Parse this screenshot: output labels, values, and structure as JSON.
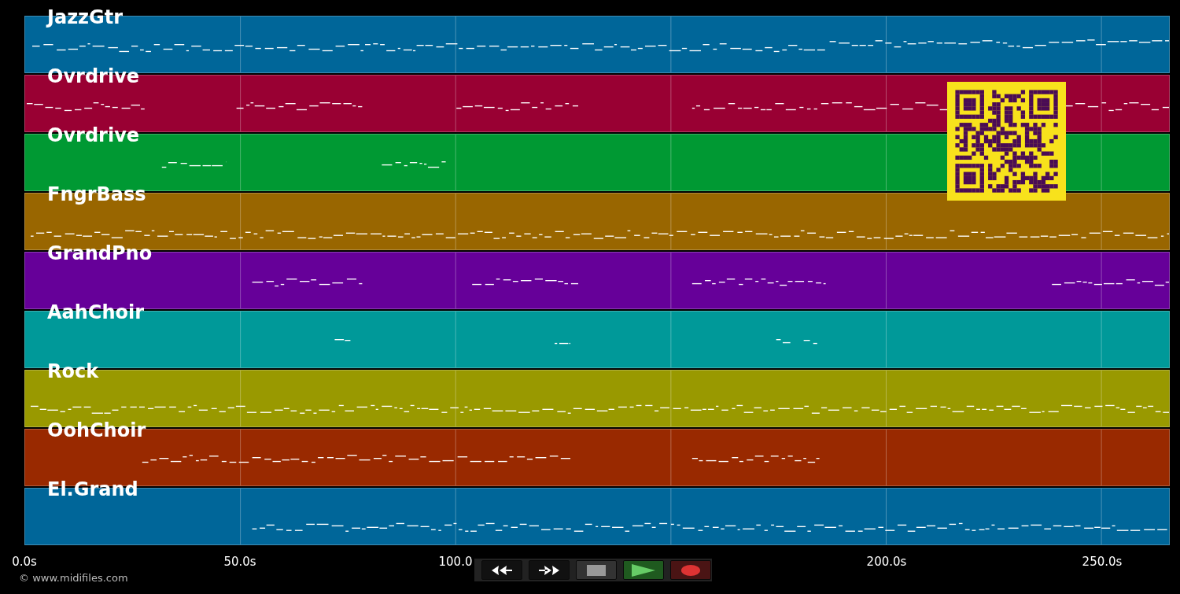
{
  "tracks": [
    {
      "name": "JazzGtr",
      "color": "#006699"
    },
    {
      "name": "Ovrdrive",
      "color": "#990033"
    },
    {
      "name": "Ovrdrive",
      "color": "#009933"
    },
    {
      "name": "FngrBass",
      "color": "#996600"
    },
    {
      "name": "GrandPno",
      "color": "#660099"
    },
    {
      "name": "AahChoir",
      "color": "#009999"
    },
    {
      "name": "Rock",
      "color": "#999900"
    },
    {
      "name": "OohChoir",
      "color": "#992900"
    },
    {
      "name": "El.Grand",
      "color": "#006699"
    }
  ],
  "time_axis": {
    "labels": [
      "0.0s",
      "50.0s",
      "100.0",
      "200.0s",
      "250.0s"
    ]
  },
  "transport": [
    {
      "kind": "rewind"
    },
    {
      "kind": "fast_forward"
    },
    {
      "kind": "stop"
    },
    {
      "kind": "play"
    },
    {
      "kind": "record"
    }
  ],
  "footer": {
    "credit": "© www.midifiles.com"
  }
}
